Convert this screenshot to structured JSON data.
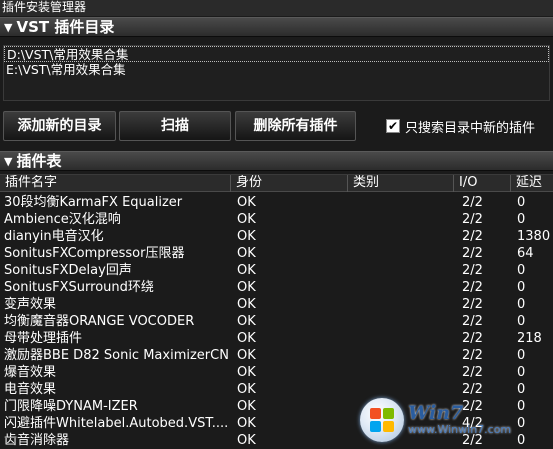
{
  "window": {
    "title": "插件安装管理器"
  },
  "vst_section": {
    "title": "VST 插件目录",
    "directories": [
      "D:\\VST\\常用效果合集",
      "E:\\VST\\常用效果合集"
    ]
  },
  "buttons": {
    "add_dir": "添加新的目录",
    "scan": "扫描",
    "delete_all": "删除所有插件"
  },
  "checkbox": {
    "label": "只搜索目录中新的插件",
    "checked_mark": "✔"
  },
  "table_section": {
    "title": "插件表",
    "columns": [
      "插件名字",
      "身份",
      "类别",
      "I/O",
      "延迟"
    ],
    "rows": [
      [
        "30段均衡KarmaFX Equalizer",
        "OK",
        "",
        "2/2",
        "0"
      ],
      [
        "Ambience汉化混响",
        "OK",
        "",
        "2/2",
        "0"
      ],
      [
        "dianyin电音汉化",
        "OK",
        "",
        "2/2",
        "1380"
      ],
      [
        "SonitusFXCompressor压限器",
        "OK",
        "",
        "2/2",
        "64"
      ],
      [
        "SonitusFXDelay回声",
        "OK",
        "",
        "2/2",
        "0"
      ],
      [
        "SonitusFXSurround环绕",
        "OK",
        "",
        "2/2",
        "0"
      ],
      [
        "变声效果",
        "OK",
        "",
        "2/2",
        "0"
      ],
      [
        "均衡魔音器ORANGE VOCODER",
        "OK",
        "",
        "2/2",
        "0"
      ],
      [
        "母带处理插件",
        "OK",
        "",
        "2/2",
        "218"
      ],
      [
        "激励器BBE D82 Sonic MaximizerCN",
        "OK",
        "",
        "2/2",
        "0"
      ],
      [
        "爆音效果",
        "OK",
        "",
        "2/2",
        "0"
      ],
      [
        "电音效果",
        "OK",
        "",
        "2/2",
        "0"
      ],
      [
        "门限降噪DYNAM-IZER",
        "OK",
        "",
        "2/2",
        "0"
      ],
      [
        "闪避插件Whitelabel.Autobed.VST....",
        "OK",
        "",
        "4/2",
        "0"
      ],
      [
        "齿音消除器",
        "OK",
        "",
        "2/2",
        "0"
      ]
    ]
  },
  "watermark": {
    "brand": "Win7",
    "url": "www.Winwin7.com"
  }
}
